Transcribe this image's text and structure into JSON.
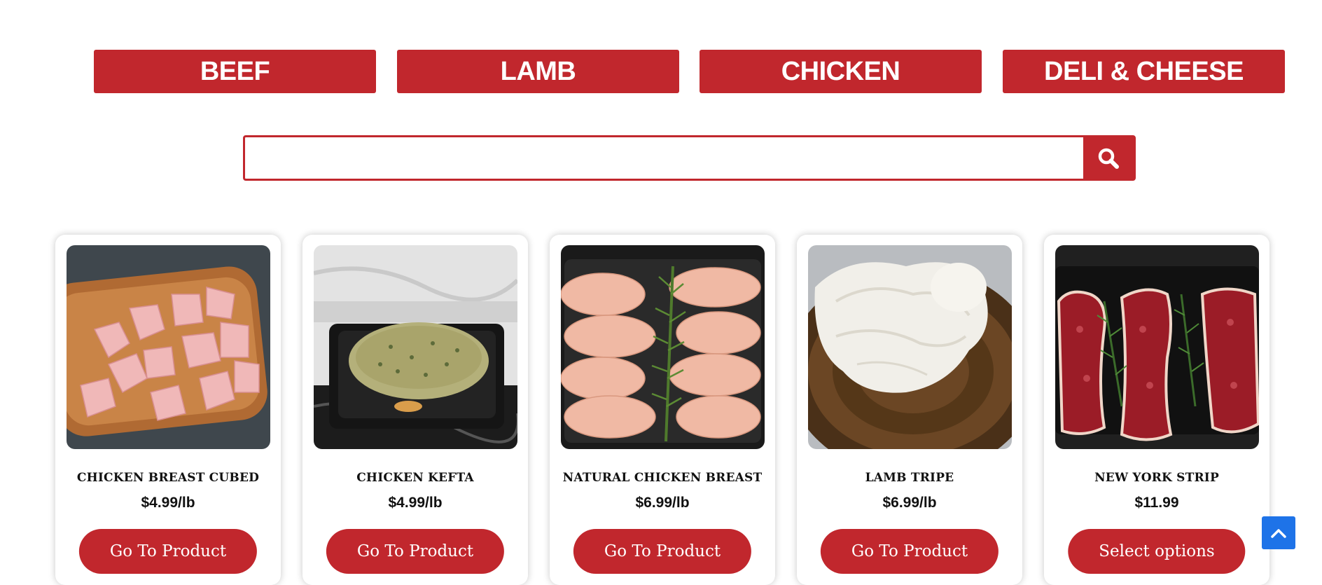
{
  "categories": [
    "BEEF",
    "LAMB",
    "CHICKEN",
    "DELI & CHEESE"
  ],
  "search": {
    "value": "",
    "placeholder": "",
    "icon": "search-icon"
  },
  "products": [
    {
      "name": "CHICKEN BREAST CUBED",
      "price": "$4.99/lb",
      "button": "Go To Product"
    },
    {
      "name": "CHICKEN KEFTA",
      "price": "$4.99/lb",
      "button": "Go To Product"
    },
    {
      "name": "NATURAL CHICKEN BREAST",
      "price": "$6.99/lb",
      "button": "Go To Product"
    },
    {
      "name": "LAMB TRIPE",
      "price": "$6.99/lb",
      "button": "Go To Product"
    },
    {
      "name": "NEW YORK STRIP",
      "price": "$11.99",
      "button": "Select options"
    }
  ],
  "scroll_top": {
    "icon": "chevron-up-icon"
  },
  "colors": {
    "brand_red": "#c1272d",
    "scroll_blue": "#1e73e8"
  }
}
